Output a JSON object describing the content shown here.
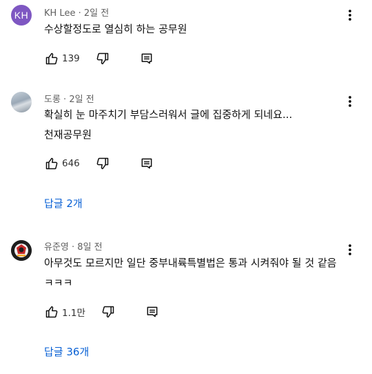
{
  "comments": [
    {
      "author": "KH Lee",
      "avatar_text": "KH",
      "time": "2일 전",
      "lines": [
        "수상할정도로 열심히 하는 공무원"
      ],
      "likes": "139",
      "replies_label": ""
    },
    {
      "author": "도롱",
      "time": "2일 전",
      "lines": [
        "확실히 눈 마주치기 부담스러워서 글에 집중하게 되네요...",
        "천재공무원"
      ],
      "likes": "646",
      "replies_label": "답글 2개"
    },
    {
      "author": "유준영",
      "time": "8일 전",
      "lines": [
        "아무것도 모르지만 일단 중부내륙특별법은 통과 시켜줘야 될 것 같음",
        "ㅋㅋㅋ"
      ],
      "likes": "1.1만",
      "replies_label": "답글 36개"
    }
  ],
  "meta_separator": " · ",
  "colors": {
    "link": "#065fd4",
    "meta": "#606060",
    "avatar_kh": "#7e57c2"
  },
  "icons": [
    "thumbs-up-icon",
    "thumbs-down-icon",
    "reply-icon",
    "more-vert-icon"
  ]
}
